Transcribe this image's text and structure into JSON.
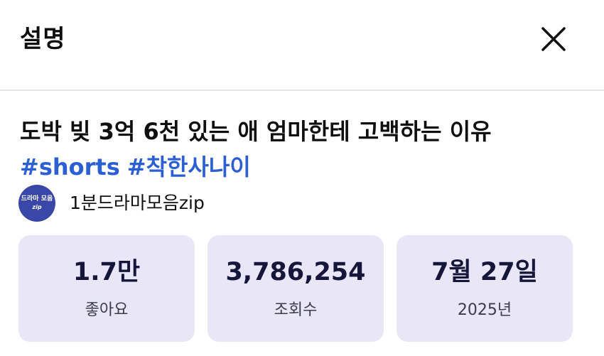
{
  "header": {
    "title": "설명",
    "close_icon": "close-icon"
  },
  "video": {
    "title": "도박 빚 3억 6천 있는 애 엄마한테 고백하는 이유",
    "hashtags": [
      "#shorts",
      "#착한사나이"
    ]
  },
  "channel": {
    "avatar_text_line1": "드라마 모음",
    "avatar_text_line2": "zip",
    "name": "1분드라마모음zip",
    "avatar_color": "#3a47a8"
  },
  "stats": [
    {
      "value": "1.7만",
      "label": "좋아요"
    },
    {
      "value": "3,786,254",
      "label": "조회수"
    },
    {
      "value": "7월 27일",
      "label": "2025년"
    }
  ],
  "colors": {
    "hashtag": "#2c5fd3",
    "card_background": "#e9e7f7",
    "stat_value": "#16163a"
  }
}
